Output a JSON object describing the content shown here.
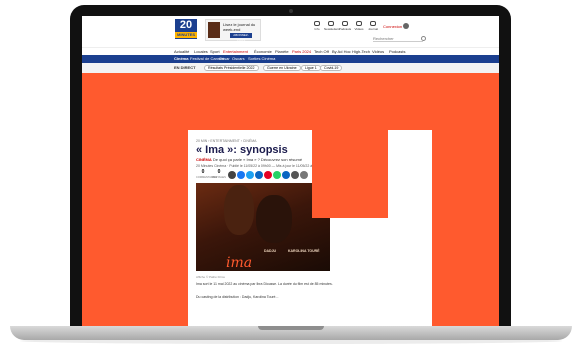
{
  "site": {
    "logo_text": "20",
    "logo_sub": "MINUTES",
    "promo": {
      "text": "Lisez le journal du week-end",
      "button": "ABONNEZ-VOUS"
    },
    "utilities": [
      {
        "label": "Info",
        "icon": "chat-icon"
      },
      {
        "label": "Newsletters",
        "icon": "mail-icon"
      },
      {
        "label": "Podcasts",
        "icon": "mic-icon"
      },
      {
        "label": "Vidéos",
        "icon": "play-icon"
      },
      {
        "label": "Journal",
        "icon": "newspaper-icon"
      }
    ],
    "login": "Connexion",
    "search_placeholder": "Rechercher"
  },
  "nav": {
    "items": [
      "Actualité",
      "Locales",
      "Sport",
      "Entertainment",
      "Économie",
      "Planète",
      "Paris 2024",
      "Tech Off",
      "By Ad Hoc",
      "High-Tech",
      "Vidéos",
      "Podcasts"
    ]
  },
  "subnav": {
    "items": [
      "Cinéma",
      "Festival de Cannes",
      "César",
      "Oscars",
      "Sorties Cinéma"
    ]
  },
  "trending": {
    "label": "EN DIRECT",
    "chips": [
      "Résultats Présidentielle 2022",
      "Guerre en Ukraine",
      "Ligue 1",
      "Covid-19"
    ]
  },
  "article": {
    "breadcrumb": "20 MIN › ENTERTAINMENT › CINÉMA",
    "title": "« Ima »: synopsis",
    "lede_prefix": "CINÉMA",
    "lede": "De quoi ça parle « Ima » ? Découvrez son résumé",
    "byline": "20 Minutes Cinéma · Publié le 11/05/22 à 09h00 — Mis à jour le 11/05/22 à 09h00",
    "comments_count": "0",
    "comments_label": "COMMENTAIRES",
    "shares_count": "0",
    "shares_label": "PARTAGES",
    "hero_names": [
      "DADJU",
      "KAROLINA TOURÉ"
    ],
    "hero_word": "ima",
    "caption": "Affiche © Pathé Films",
    "body": "Ima sort le 11 mai 2022 au cinéma par Ibra Diousse. La durée du film est de 85 minutes.",
    "body2": "Du casting de la distribution : Dadju, Karolina Touré..."
  },
  "colors": {
    "background": "#ff5a2e",
    "brand_blue": "#1b3f8f",
    "share_icons": [
      "#444444",
      "#1877f2",
      "#1da1f2",
      "#0a66c2",
      "#e60023",
      "#25d366",
      "#0a66c2",
      "#555555",
      "#777777"
    ]
  }
}
